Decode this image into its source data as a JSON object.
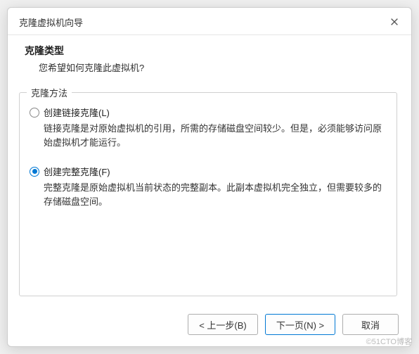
{
  "dialog": {
    "title": "克隆虚拟机向导",
    "header": {
      "title": "克隆类型",
      "subtitle": "您希望如何克隆此虚拟机?"
    },
    "group": {
      "label": "克隆方法",
      "options": [
        {
          "label": "创建链接克隆(L)",
          "desc": "链接克隆是对原始虚拟机的引用，所需的存储磁盘空间较少。但是，必须能够访问原始虚拟机才能运行。",
          "selected": false
        },
        {
          "label": "创建完整克隆(F)",
          "desc": "完整克隆是原始虚拟机当前状态的完整副本。此副本虚拟机完全独立，但需要较多的存储磁盘空间。",
          "selected": true
        }
      ]
    },
    "buttons": {
      "back": "< 上一步(B)",
      "next": "下一页(N) >",
      "cancel": "取消"
    }
  },
  "watermark": "©51CTO博客"
}
